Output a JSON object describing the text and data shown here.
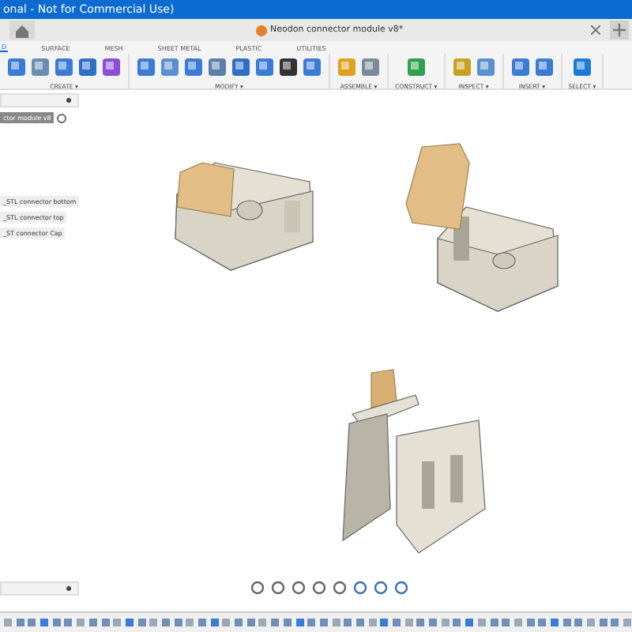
{
  "window": {
    "title": "onal - Not for Commercial Use)"
  },
  "document_tab": {
    "title": "Neodon connector module v8*"
  },
  "ribbon_tabs": [
    {
      "label": "D",
      "selected": true
    },
    {
      "label": "SURFACE",
      "selected": false
    },
    {
      "label": "MESH",
      "selected": false
    },
    {
      "label": "SHEET METAL",
      "selected": false
    },
    {
      "label": "PLASTIC",
      "selected": false
    },
    {
      "label": "UTILITIES",
      "selected": false
    }
  ],
  "tool_groups": [
    {
      "label": "CREATE ▾"
    },
    {
      "label": "MODIFY ▾"
    },
    {
      "label": "ASSEMBLE ▾"
    },
    {
      "label": "CONSTRUCT ▾"
    },
    {
      "label": "INSPECT ▾"
    },
    {
      "label": "INSERT ▾"
    },
    {
      "label": "SELECT ▾"
    }
  ],
  "browser": {
    "root": "ctor module v8",
    "items": [
      {
        "label": "_STL connector bottom"
      },
      {
        "label": "_STL connector top"
      },
      {
        "label": "_ST connector Cap"
      }
    ]
  }
}
